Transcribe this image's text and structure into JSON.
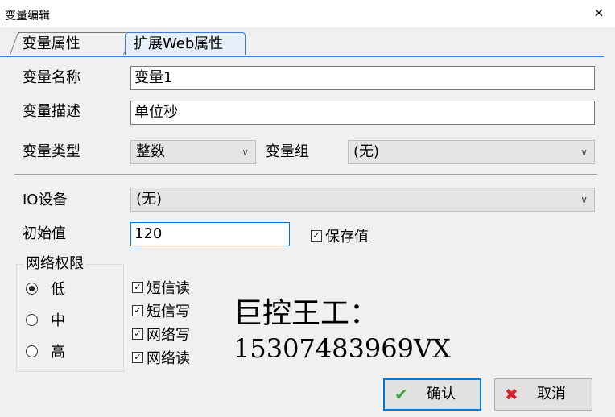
{
  "window": {
    "title": "变量编辑",
    "close": "×"
  },
  "tabs": [
    {
      "label": "变量属性"
    },
    {
      "label": "扩展Web属性"
    }
  ],
  "form": {
    "name_label": "变量名称",
    "name_value": "变量1",
    "desc_label": "变量描述",
    "desc_value": "单位秒",
    "type_label": "变量类型",
    "type_value": "整数",
    "group_label": "变量组",
    "group_value": "(无)",
    "io_label": "IO设备",
    "io_value": "(无)",
    "init_label": "初始值",
    "init_value": "120",
    "save_value_label": "保存值"
  },
  "network": {
    "title": "网络权限",
    "options": [
      "低",
      "中",
      "高"
    ],
    "selected": "低"
  },
  "permissions": [
    "短信读",
    "短信写",
    "网络写",
    "网络读"
  ],
  "overlay": {
    "line1": "巨控王工：",
    "line2": "15307483969VX"
  },
  "buttons": {
    "ok": "确认",
    "cancel": "取消"
  },
  "colors": {
    "accent": "#0078d7",
    "tab_line": "#3d7bd5",
    "ok_icon": "#3aa53a",
    "cancel_icon": "#d8232a"
  }
}
